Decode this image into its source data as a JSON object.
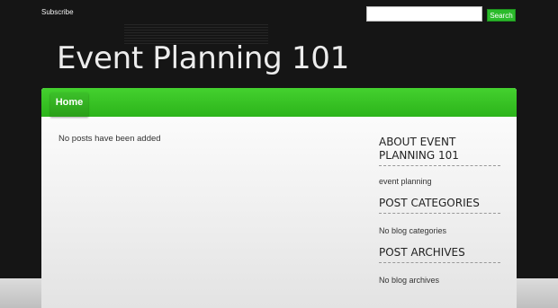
{
  "topbar": {
    "subscribe_label": "Subscribe",
    "search_placeholder": "",
    "search_button_label": "Search"
  },
  "site": {
    "title": "Event Planning 101"
  },
  "nav": {
    "items": [
      {
        "label": "Home"
      }
    ]
  },
  "main": {
    "empty_message": "No posts have been added"
  },
  "sidebar": {
    "about": {
      "heading": "ABOUT EVENT PLANNING 101",
      "text": "event planning"
    },
    "categories": {
      "heading": "POST CATEGORIES",
      "text": "No blog categories"
    },
    "archives": {
      "heading": "POST ARCHIVES",
      "text": "No blog archives"
    }
  },
  "colors": {
    "accent": "#2cb41a",
    "background": "#151515",
    "panel": "#f4f4f4"
  }
}
